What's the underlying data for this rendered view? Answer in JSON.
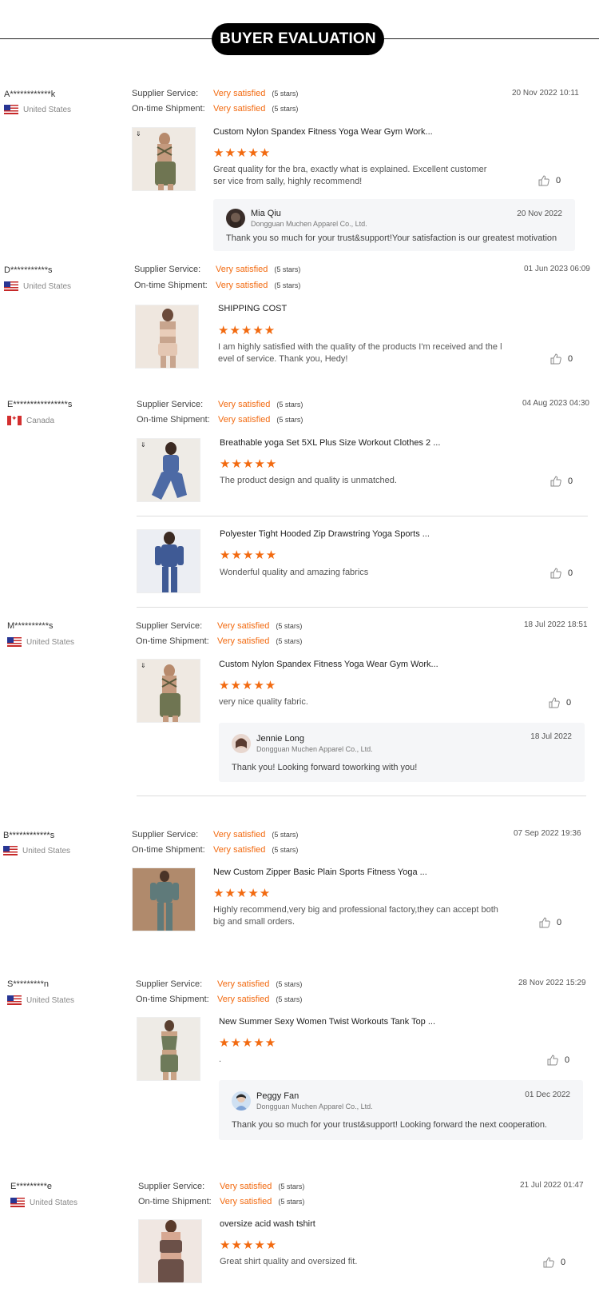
{
  "header": {
    "title": "BUYER EVALUATION"
  },
  "labels": {
    "supplier_service": "Supplier Service:",
    "ontime_shipment": "On-time Shipment:"
  },
  "colors": {
    "accent": "#f26a10",
    "header_bg": "#000000"
  },
  "reviews": [
    {
      "user": "A************k",
      "country": "United States",
      "flag": "us",
      "supplier_service": "Very satisfied",
      "supplier_stars": "(5 stars)",
      "ontime": "Very satisfied",
      "ontime_stars": "(5 stars)",
      "date": "20 Nov 2022 10:11",
      "products": [
        {
          "title": "Custom Nylon Spandex Fitness Yoga Wear Gym Work...",
          "rating": 5,
          "stars": "★★★★★",
          "text": "Great quality for the bra, exactly what is explained. Excellent customer ser vice from sally, highly recommend!",
          "likes": "0"
        }
      ],
      "reply": {
        "name": "Mia Qiu",
        "company": "Dongguan Muchen Apparel Co., Ltd.",
        "date": "20 Nov 2022",
        "text": "Thank you so much for your trust&support!Your satisfaction is our greatest motivation"
      }
    },
    {
      "user": "D***********s",
      "country": "United States",
      "flag": "us",
      "supplier_service": "Very satisfied",
      "supplier_stars": "(5 stars)",
      "ontime": "Very satisfied",
      "ontime_stars": "(5 stars)",
      "date": "01 Jun 2023 06:09",
      "products": [
        {
          "title": "SHIPPING COST",
          "rating": 5,
          "stars": "★★★★★",
          "text": "I am highly satisfied with the quality of the products I'm received and the l evel of service. Thank you, Hedy!",
          "likes": "0"
        }
      ]
    },
    {
      "user": "E****************s",
      "country": "Canada",
      "flag": "ca",
      "supplier_service": "Very satisfied",
      "supplier_stars": "(5 stars)",
      "ontime": "Very satisfied",
      "ontime_stars": "(5 stars)",
      "date": "04 Aug 2023 04:30",
      "products": [
        {
          "title": "Breathable yoga Set 5XL Plus Size Workout Clothes 2 ...",
          "rating": 5,
          "stars": "★★★★★",
          "text": "The product design and quality is unmatched.",
          "likes": "0"
        },
        {
          "title": "Polyester Tight Hooded Zip Drawstring Yoga Sports ...",
          "rating": 5,
          "stars": "★★★★★",
          "text": "Wonderful quality and amazing fabrics",
          "likes": "0"
        }
      ]
    },
    {
      "user": "M**********s",
      "country": "United States",
      "flag": "us",
      "supplier_service": "Very satisfied",
      "supplier_stars": "(5 stars)",
      "ontime": "Very satisfied",
      "ontime_stars": "(5 stars)",
      "date": "18 Jul 2022 18:51",
      "products": [
        {
          "title": "Custom Nylon Spandex Fitness Yoga Wear Gym Work...",
          "rating": 5,
          "stars": "★★★★★",
          "text": "very nice quality fabric.",
          "likes": "0"
        }
      ],
      "reply": {
        "name": "Jennie Long",
        "company": "Dongguan Muchen Apparel Co., Ltd.",
        "date": "18 Jul 2022",
        "text": "Thank you! Looking forward toworking with you!"
      }
    },
    {
      "user": "B************s",
      "country": "United States",
      "flag": "us",
      "supplier_service": "Very satisfied",
      "supplier_stars": "(5 stars)",
      "ontime": "Very satisfied",
      "ontime_stars": "(5 stars)",
      "date": "07 Sep 2022 19:36",
      "products": [
        {
          "title": "New Custom Zipper Basic Plain Sports Fitness Yoga ...",
          "rating": 5,
          "stars": "★★★★★",
          "text": "Highly recommend,very big and professional factory,they can accept both big and small orders.",
          "likes": "0"
        }
      ]
    },
    {
      "user": "S*********n",
      "country": "United States",
      "flag": "us",
      "supplier_service": "Very satisfied",
      "supplier_stars": "(5 stars)",
      "ontime": "Very satisfied",
      "ontime_stars": "(5 stars)",
      "date": "28 Nov 2022 15:29",
      "products": [
        {
          "title": "New Summer Sexy Women Twist Workouts Tank Top ...",
          "rating": 5,
          "stars": "★★★★★",
          "text": ".",
          "likes": "0"
        }
      ],
      "reply": {
        "name": "Peggy Fan",
        "company": "Dongguan Muchen Apparel Co., Ltd.",
        "date": "01 Dec 2022",
        "text": "Thank you so much for your trust&support! Looking forward the next cooperation."
      }
    },
    {
      "user": "E*********e",
      "country": "United States",
      "flag": "us",
      "supplier_service": "Very satisfied",
      "supplier_stars": "(5 stars)",
      "ontime": "Very satisfied",
      "ontime_stars": "(5 stars)",
      "date": "21 Jul 2022 01:47",
      "products": [
        {
          "title": "oversize acid wash tshirt",
          "rating": 5,
          "stars": "★★★★★",
          "text": "Great shirt quality and oversized fit.",
          "likes": "0"
        }
      ]
    }
  ]
}
